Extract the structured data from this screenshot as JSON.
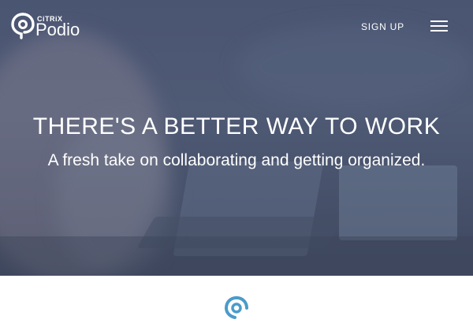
{
  "header": {
    "brand_small": "CiTRiX",
    "brand_name": "Podio",
    "signup_label": "SIGN UP",
    "menu_icon": "hamburger-menu-icon"
  },
  "hero": {
    "headline": "THERE'S A BETTER WAY TO WORK",
    "subheadline": "A fresh take on collaborating and getting organized."
  },
  "colors": {
    "hero_overlay": "#4a5572",
    "text": "#ffffff",
    "brand_accent": "#4a9cc9"
  },
  "icons": [
    "podio-logo-icon",
    "hamburger-menu-icon",
    "podio-mark-icon"
  ]
}
